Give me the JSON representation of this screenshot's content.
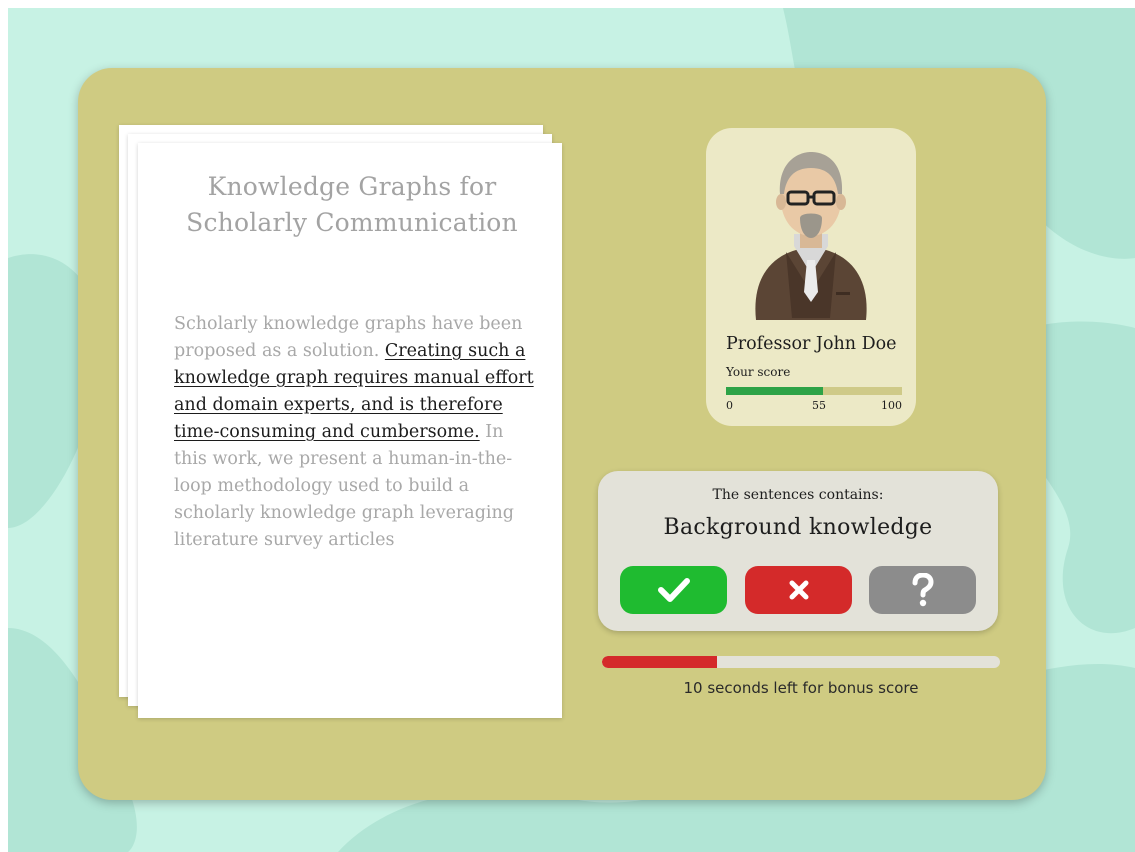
{
  "paper": {
    "title": "Knowledge Graphs for Scholarly Communication",
    "text_before": "Scholarly knowledge graphs have been proposed as a solution. ",
    "text_highlight": "Creating such a knowledge graph requires manual effort and domain experts, and is therefore time-consuming and cumbersome.",
    "text_after": " In this work, we present a human-in-the-loop methodology used to build a scholarly knowledge graph leveraging literature survey articles"
  },
  "professor": {
    "name": "Professor John Doe",
    "score_label": "Your score",
    "score_value": 55,
    "score_min": "0",
    "score_mid": "55",
    "score_max": "100"
  },
  "question": {
    "prompt": "The sentences contains:",
    "category": "Background knowledge",
    "buttons": [
      {
        "id": "yes",
        "icon": "check-icon",
        "color": "#1fbb30"
      },
      {
        "id": "no",
        "icon": "cross-icon",
        "color": "#d42a2a"
      },
      {
        "id": "unsure",
        "icon": "question-icon",
        "color": "#8c8c8c"
      }
    ]
  },
  "timer": {
    "fraction_remaining": 0.29,
    "text": "10 seconds left for bonus score",
    "fill_color": "#d42a2a"
  },
  "colors": {
    "background": "#c7f2e4",
    "board": "#cfcb82",
    "score_fill": "#2ea347"
  }
}
